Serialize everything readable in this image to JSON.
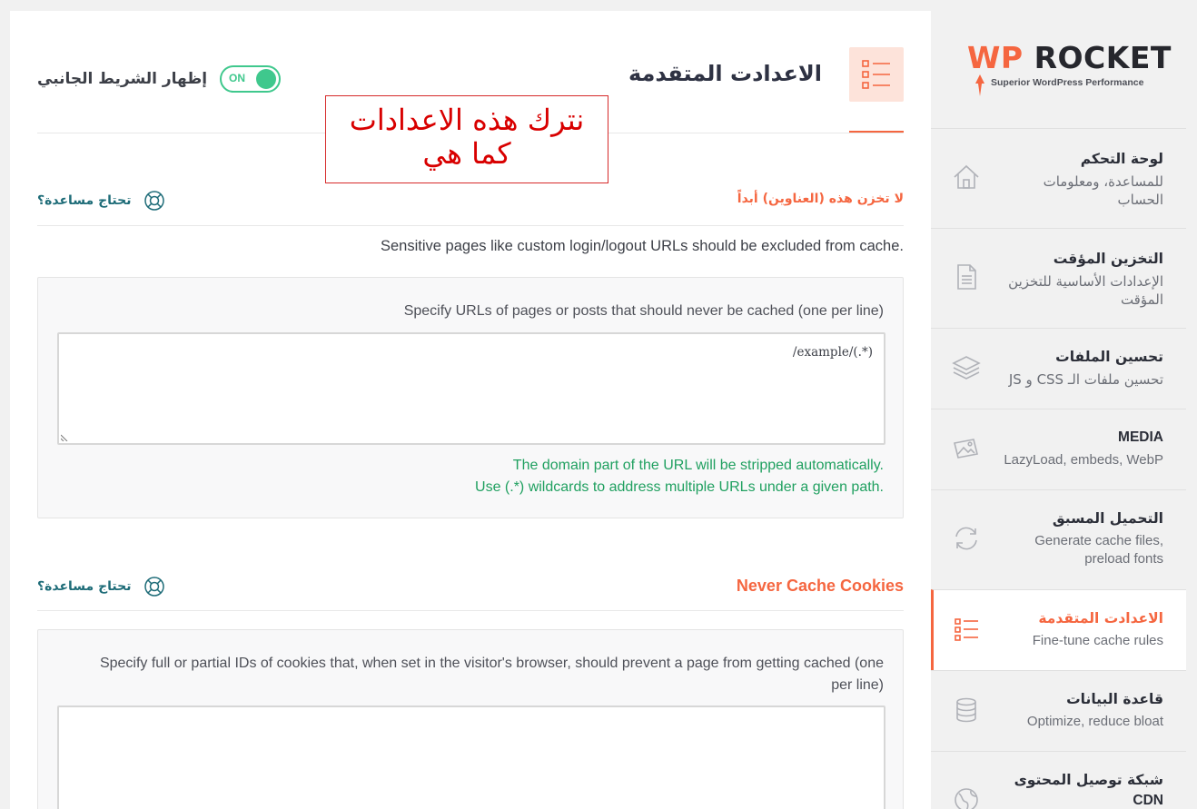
{
  "header": {
    "title": "الاعدادت المتقدمة",
    "sidebar_toggle_label": "إظهار الشريط الجانبي",
    "toggle_state": "ON"
  },
  "annotation": {
    "line1": "نترك هذه الاعدادات",
    "line2": "كما هي"
  },
  "section_never_cache_urls": {
    "title": "لا تخزن هذه (العناوين) أبداً",
    "help_label": "تحتاج مساعدة؟",
    "description": "Sensitive pages like custom login/logout URLs should be excluded from cache.",
    "field_label": "Specify URLs of pages or posts that should never be cached (one per line)",
    "field_value": "/example/(.*)",
    "hint_line1": "The domain part of the URL will be stripped automatically.",
    "hint_line2": "Use (.*) wildcards to address multiple URLs under a given path."
  },
  "section_never_cache_cookies": {
    "title": "Never Cache Cookies",
    "help_label": "تحتاج مساعدة؟",
    "field_label_line1": "Specify full or partial IDs of cookies that, when set in the visitor's browser, should prevent a page from getting cached (one",
    "field_label_line2": "per line)",
    "field_value": ""
  },
  "sidebar": {
    "logo_wp": "WP",
    "logo_rocket": "ROCKET",
    "logo_tagline": "Superior WordPress Performance",
    "items": [
      {
        "title": "لوحة التحكم",
        "subtitle_line1": "للمساعدة، ومعلومات",
        "subtitle_line2": "الحساب",
        "icon": "home-icon"
      },
      {
        "title": "التخزين المؤقت",
        "subtitle_line1": "الإعدادات الأساسية للتخزين",
        "subtitle_line2": "المؤقت",
        "icon": "document-icon"
      },
      {
        "title": "تحسين الملفات",
        "subtitle_line1": "تحسين ملفات الـ CSS و JS",
        "subtitle_line2": "",
        "icon": "layers-icon"
      },
      {
        "title": "MEDIA",
        "subtitle_line1": "LazyLoad, embeds, WebP",
        "subtitle_line2": "",
        "icon": "images-icon"
      },
      {
        "title": "التحميل المسبق",
        "subtitle_line1": "Generate cache files,",
        "subtitle_line2": "preload fonts",
        "icon": "refresh-icon"
      },
      {
        "title": "الاعدادت المتقدمة",
        "subtitle_line1": "Fine-tune cache rules",
        "subtitle_line2": "",
        "icon": "checklist-icon",
        "active": true
      },
      {
        "title": "قاعدة البيانات",
        "subtitle_line1": "Optimize, reduce bloat",
        "subtitle_line2": "",
        "icon": "database-icon"
      },
      {
        "title": "شبكة توصيل المحتوى",
        "subtitle_line1": "CDN",
        "subtitle_line2": "",
        "icon": "globe-icon"
      }
    ]
  },
  "colors": {
    "accent": "#f56640",
    "toggle_on": "#3fc88d",
    "help_link": "#1e6c78",
    "hint_green": "#20a060",
    "annotation_red": "#d80000"
  }
}
